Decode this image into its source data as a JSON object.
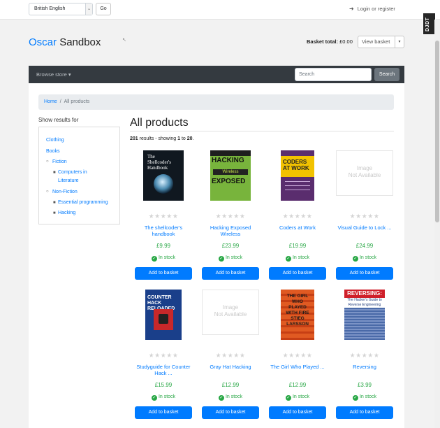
{
  "topbar": {
    "language": "British English",
    "go_label": "Go",
    "login_label": "Login or register",
    "djdt_label": "DJDT"
  },
  "header": {
    "brand_main": "Oscar",
    "brand_sub": "Sandbox",
    "basket_total_label": "Basket total:",
    "basket_total_value": "£0.00",
    "view_basket_label": "View basket"
  },
  "nav": {
    "browse_label": "Browse store",
    "search_placeholder": "Search",
    "search_button": "Search"
  },
  "breadcrumb": {
    "home": "Home",
    "current": "All products"
  },
  "sidebar": {
    "title": "Show results for",
    "items": [
      "Clothing",
      "Books",
      "Fiction",
      "Computers in",
      "Literature",
      "Non-Fiction",
      "Essential programming",
      "Hacking"
    ]
  },
  "main": {
    "heading": "All products",
    "results_count": "201",
    "results_text": "results - showing",
    "results_from": "1",
    "results_to_word": "to",
    "results_to": "20"
  },
  "products": [
    {
      "title": "The shellcoder's handbook",
      "price": "£9.99",
      "stock": "In stock",
      "add": "Add to basket",
      "cover": "shellcoder",
      "cover_text": "The Shellcoder's Handbook"
    },
    {
      "title": "Hacking Exposed Wireless",
      "price": "£23.99",
      "stock": "In stock",
      "add": "Add to basket",
      "cover": "hacking",
      "cover_text": "HACKING Wireless EXPOSED"
    },
    {
      "title": "Coders at Work",
      "price": "£19.99",
      "stock": "In stock",
      "add": "Add to basket",
      "cover": "coders",
      "cover_text": "CODERS AT WORK"
    },
    {
      "title": "Visual Guide to Lock ...",
      "price": "£24.99",
      "stock": "In stock",
      "add": "Add to basket",
      "cover": "na",
      "cover_text": "Image Not Available"
    },
    {
      "title": "Studyguide for Counter Hack ...",
      "price": "£15.99",
      "stock": "In stock",
      "add": "Add to basket",
      "cover": "counter",
      "cover_text": "COUNTER HACK RELOADED"
    },
    {
      "title": "Gray Hat Hacking",
      "price": "£12.99",
      "stock": "In stock",
      "add": "Add to basket",
      "cover": "na",
      "cover_text": "Image Not Available"
    },
    {
      "title": "The Girl Who Played ...",
      "price": "£12.99",
      "stock": "In stock",
      "add": "Add to basket",
      "cover": "girl",
      "cover_text": "THE GIRL WHO PLAYED WITH FIRE STIEG LARSSON"
    },
    {
      "title": "Reversing",
      "price": "£3.99",
      "stock": "In stock",
      "add": "Add to basket",
      "cover": "reversing",
      "cover_text": "REVERSING: The Hacker's Guide to Reverse Engineering"
    }
  ],
  "colors": {
    "link": "#007bff",
    "price": "#28a745",
    "navbar": "#343a40",
    "button": "#007bff"
  }
}
